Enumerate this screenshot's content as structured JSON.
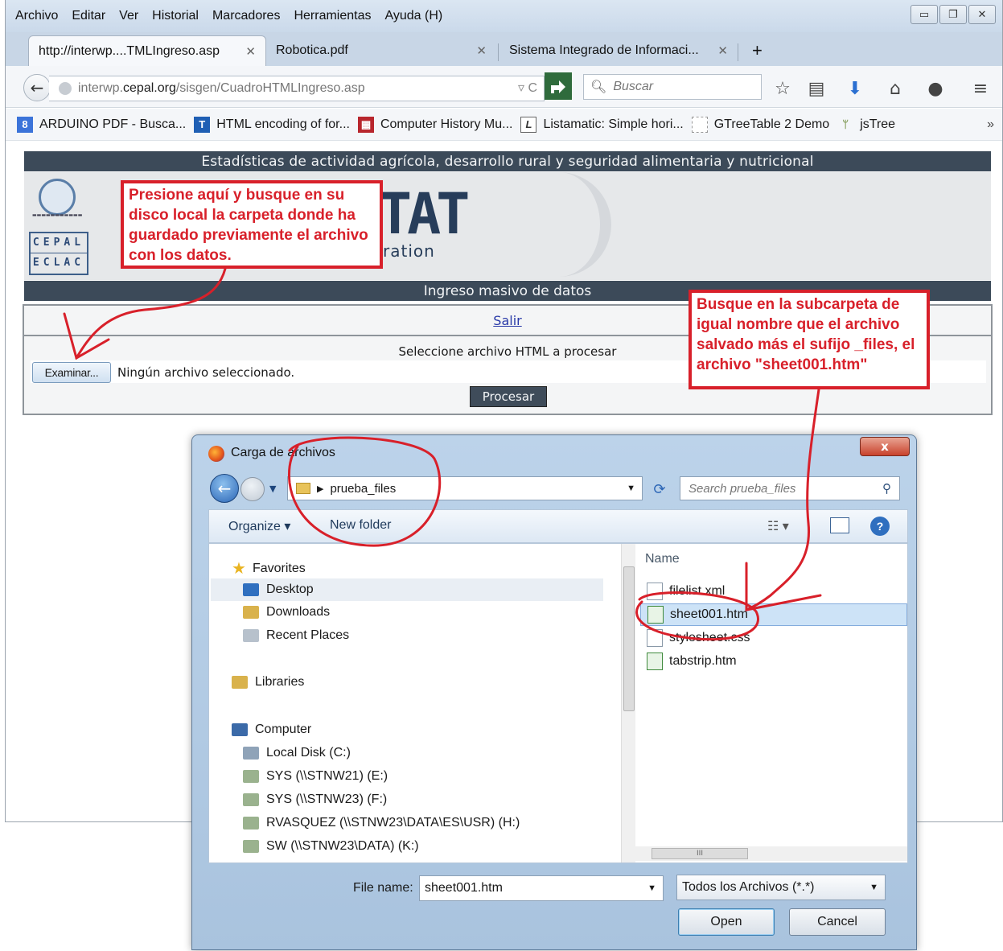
{
  "browser": {
    "menu": [
      "Archivo",
      "Editar",
      "Ver",
      "Historial",
      "Marcadores",
      "Herramientas",
      "Ayuda (H)"
    ],
    "tabs": [
      {
        "label": "http://interwp....TMLIngreso.asp",
        "active": true
      },
      {
        "label": "Robotica.pdf",
        "active": false
      },
      {
        "label": "Sistema Integrado de Informaci...",
        "active": false
      }
    ],
    "new_tab": "+",
    "url": {
      "prefix": "interwp.",
      "host": "cepal.org",
      "path": "/sisgen/CuadroHTMLIngreso.asp"
    },
    "search_placeholder": "Buscar",
    "bookmarks": [
      {
        "label": "ARDUINO PDF - Busca...",
        "icon": "google-icon",
        "color": "#3b73d9"
      },
      {
        "label": "HTML encoding of for...",
        "icon": "t-icon",
        "color": "#1f5fb4"
      },
      {
        "label": "Computer History Mu...",
        "icon": "chm-icon",
        "color": "#b8262d"
      },
      {
        "label": "Listamatic: Simple hori...",
        "icon": "l-icon",
        "color": "#666666"
      },
      {
        "label": "GTreeTable 2 Demo",
        "icon": "blank-page-icon",
        "color": "#999999"
      },
      {
        "label": "jsTree",
        "icon": "tree-icon",
        "color": "#88a060"
      }
    ],
    "bookmarks_overflow": "»"
  },
  "page": {
    "header": "Estadísticas de actividad agrícola, desarrollo rural y seguridad alimentaria y nutricional",
    "logo_title": "TAT",
    "logo_sub": "ration",
    "logo_cepal": "CEPAL",
    "logo_eclac": "ECLAC",
    "section": "Ingreso masivo de datos",
    "salir": "Salir",
    "select_label": "Seleccione archivo HTML a procesar",
    "examinar": "Examinar...",
    "file_status": "Ningún archivo seleccionado.",
    "procesar": "Procesar"
  },
  "callouts": {
    "left": "Presione aquí y busque en su disco local la carpeta donde ha guardado previamente el archivo con los datos.",
    "right": "Busque en la subcarpeta de igual nombre que el archivo salvado más el sufijo _files, el archivo \"sheet001.htm\""
  },
  "dialog": {
    "title": "Carga de archivos",
    "close": "x",
    "path": "prueba_files",
    "search_placeholder": "Search prueba_files",
    "organize": "Organize",
    "new_folder": "New folder",
    "nav": [
      {
        "label": "Favorites",
        "icon": "star-icon",
        "level": 0
      },
      {
        "label": "Desktop",
        "icon": "desktop-icon",
        "level": 1
      },
      {
        "label": "Downloads",
        "icon": "downloads-icon",
        "level": 1
      },
      {
        "label": "Recent Places",
        "icon": "recent-places-icon",
        "level": 1
      },
      {
        "label": "Libraries",
        "icon": "libraries-icon",
        "level": 0
      },
      {
        "label": "Computer",
        "icon": "computer-icon",
        "level": 0
      },
      {
        "label": "Local Disk (C:)",
        "icon": "local-disk-icon",
        "level": 1
      },
      {
        "label": "SYS (\\\\STNW21) (E:)",
        "icon": "network-drive-icon",
        "level": 1
      },
      {
        "label": "SYS (\\\\STNW23) (F:)",
        "icon": "network-drive-icon",
        "level": 1
      },
      {
        "label": "RVASQUEZ (\\\\STNW23\\DATA\\ES\\USR) (H:)",
        "icon": "network-drive-icon",
        "level": 1
      },
      {
        "label": "SW (\\\\STNW23\\DATA) (K:)",
        "icon": "network-drive-icon",
        "level": 1
      }
    ],
    "column_name": "Name",
    "files": [
      {
        "label": "filelist.xml",
        "icon": "xml-file-icon",
        "selected": false
      },
      {
        "label": "sheet001.htm",
        "icon": "excel-htm-icon",
        "selected": true
      },
      {
        "label": "stylesheet.css",
        "icon": "css-file-icon",
        "selected": false
      },
      {
        "label": "tabstrip.htm",
        "icon": "excel-htm-icon",
        "selected": false
      }
    ],
    "scroll_mark": "III",
    "file_name_label": "File name:",
    "file_name_value": "sheet001.htm",
    "file_type": "Todos los Archivos (*.*)",
    "open": "Open",
    "cancel": "Cancel"
  },
  "colors": {
    "accent_red": "#d8202a",
    "header_bar": "#3c4a59",
    "link": "#2a3aa8"
  }
}
